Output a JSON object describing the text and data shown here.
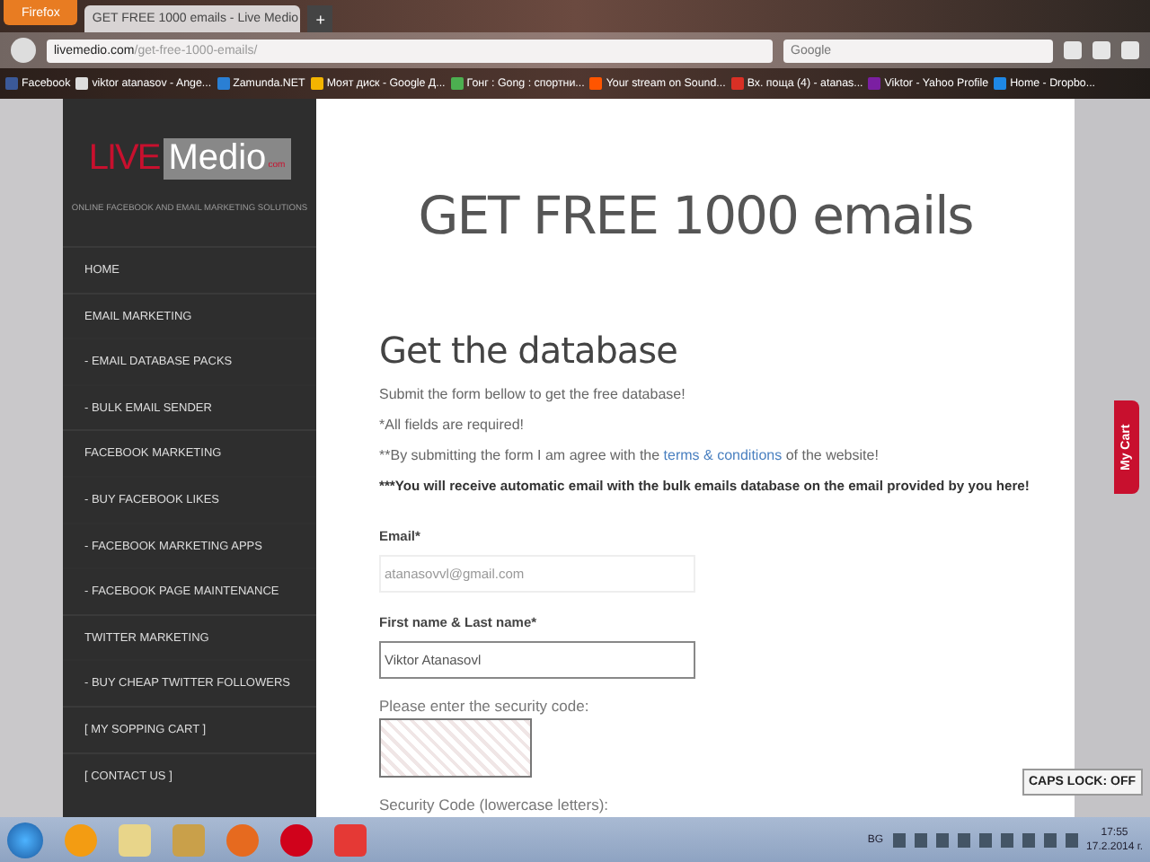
{
  "browser": {
    "menu_button": "Firefox",
    "tabs": [
      {
        "title": "GET FREE 1000 emails - Live Medio",
        "selected": true
      }
    ],
    "new_tab": "+",
    "address": {
      "domain": "livemedio.com",
      "path": "/get-free-1000-emails/"
    },
    "search": {
      "placeholder": "Google"
    },
    "bookmarks": [
      {
        "label": "Facebook",
        "color": "#3b5998"
      },
      {
        "label": "viktor atanasov - Ange...",
        "color": "#dddddd"
      },
      {
        "label": "Zamunda.NET",
        "color": "#2a7fd4"
      },
      {
        "label": "Моят диск - Google Д...",
        "color": "#f4b400"
      },
      {
        "label": "Гонг : Gong : спортни...",
        "color": "#4caf50"
      },
      {
        "label": "Your stream on Sound...",
        "color": "#ff5500"
      },
      {
        "label": "Вх. поща (4) - atanas...",
        "color": "#d93025"
      },
      {
        "label": "Viktor - Yahoo Profile",
        "color": "#7b1fa2"
      },
      {
        "label": "Home - Dropbo...",
        "color": "#1e88e5"
      }
    ]
  },
  "sidebar": {
    "logo": {
      "left": "LIVE",
      "right": "Medio",
      "suffix": "com"
    },
    "tagline": "ONLINE FACEBOOK AND EMAIL MARKETING SOLUTIONS",
    "items": [
      {
        "label": "HOME",
        "kind": "top"
      },
      {
        "label": "EMAIL MARKETING",
        "kind": "top"
      },
      {
        "label": "- EMAIL DATABASE PACKS",
        "kind": "sub"
      },
      {
        "label": "- BULK EMAIL SENDER",
        "kind": "sub"
      },
      {
        "label": "FACEBOOK MARKETING",
        "kind": "top"
      },
      {
        "label": "- BUY FACEBOOK LIKES",
        "kind": "sub"
      },
      {
        "label": "- FACEBOOK MARKETING APPS",
        "kind": "sub"
      },
      {
        "label": "- FACEBOOK PAGE MAINTENANCE",
        "kind": "sub"
      },
      {
        "label": "TWITTER MARKETING",
        "kind": "top"
      },
      {
        "label": "- BUY CHEAP TWITTER FOLLOWERS",
        "kind": "sub"
      },
      {
        "label": "[ MY SOPPING CART ]",
        "kind": "top"
      },
      {
        "label": "[ CONTACT US ]",
        "kind": "top"
      }
    ]
  },
  "main": {
    "title": "GET FREE 1000 emails",
    "heading": "Get the database",
    "notes": [
      {
        "text": "Submit the form bellow to get the free database!",
        "kind": "plain"
      },
      {
        "text": "*All fields are required!",
        "kind": "plain"
      },
      {
        "before": "**By submitting the form I am agree with the ",
        "link": "terms & conditions",
        "after": " of the website!",
        "kind": "link"
      },
      {
        "text": "***You will receive automatic email with the bulk emails database on the email provided by you here!",
        "kind": "bold"
      }
    ],
    "fields": [
      {
        "label": "Email*",
        "value": "atanasovvl@gmail.com",
        "focused": false
      },
      {
        "label": "First name & Last name*",
        "value": "Viktor Atanasovl",
        "focused": true
      }
    ],
    "captcha_label": "Please enter the security code:",
    "code_label": "Security Code (lowercase letters):"
  },
  "cart_tab": "My Cart",
  "caps_lock": "CAPS LOCK: OFF",
  "taskbar": {
    "language": "BG",
    "time": "17:55",
    "date": "17.2.2014 г."
  }
}
